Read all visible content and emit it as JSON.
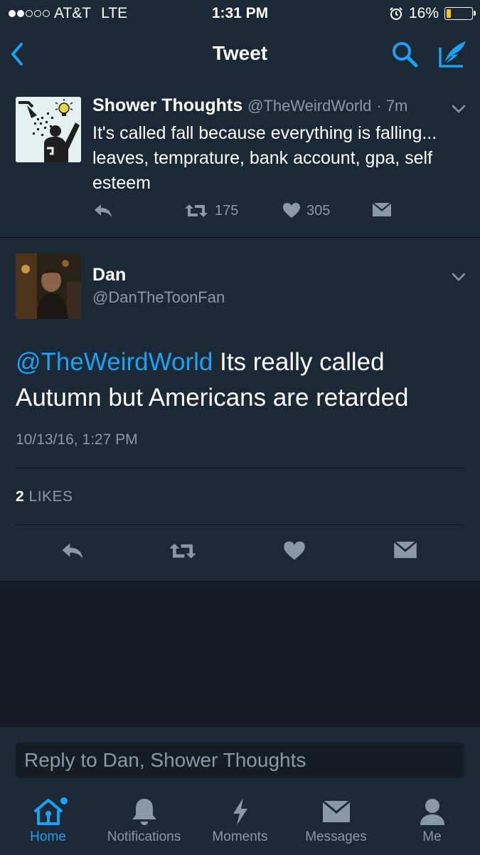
{
  "status_bar": {
    "carrier": "AT&T",
    "network": "LTE",
    "time": "1:31 PM",
    "battery_percent": "16%",
    "battery_level": 0.16,
    "signal_bars": 2
  },
  "nav": {
    "title": "Tweet"
  },
  "parent_tweet": {
    "name": "Shower Thoughts",
    "handle": "@TheWeirdWorld",
    "time": "· 7m",
    "text": "It's called fall because everything is falling... leaves, temprature, bank account, gpa, self esteem",
    "retweets": "175",
    "likes": "305"
  },
  "reply_tweet": {
    "name": "Dan",
    "handle": "@DanTheToonFan",
    "mention": "@TheWeirdWorld",
    "text": " Its really called Autumn but Americans are retarded",
    "timestamp": "10/13/16, 1:27 PM",
    "likes_count": "2",
    "likes_label": "LIKES"
  },
  "composer": {
    "placeholder": "Reply to Dan, Shower Thoughts"
  },
  "tabs": [
    {
      "label": "Home",
      "icon": "home-icon",
      "active": true
    },
    {
      "label": "Notifications",
      "icon": "bell-icon",
      "active": false
    },
    {
      "label": "Moments",
      "icon": "lightning-icon",
      "active": false
    },
    {
      "label": "Messages",
      "icon": "envelope-icon",
      "active": false
    },
    {
      "label": "Me",
      "icon": "person-icon",
      "active": false
    }
  ],
  "colors": {
    "accent": "#1da1f2",
    "background": "#141d26",
    "panel": "#1b2836",
    "muted": "#8899a6"
  }
}
